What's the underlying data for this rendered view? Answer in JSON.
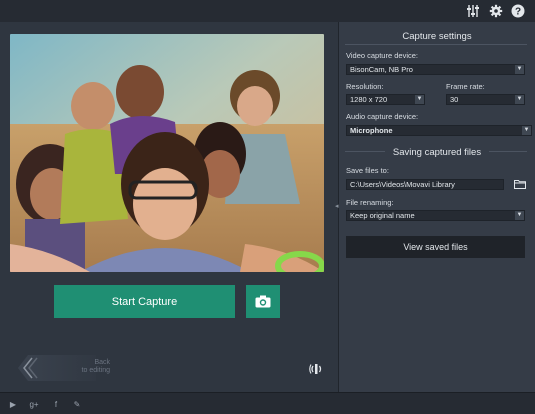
{
  "toolbar": {
    "icons": [
      "equalizer-icon",
      "gear-icon",
      "help-icon"
    ]
  },
  "preview": {
    "description_icon": "camera-preview"
  },
  "actions": {
    "start_capture": "Start Capture",
    "snapshot_icon": "camera-icon",
    "back_line1": "Back",
    "back_line2": "to editing"
  },
  "settings": {
    "capture_title": "Capture settings",
    "video_device_label": "Video capture device:",
    "video_device_value": "BisonCam, NB Pro",
    "resolution_label": "Resolution:",
    "resolution_value": "1280 x 720",
    "frame_rate_label": "Frame rate:",
    "frame_rate_value": "30",
    "audio_device_label": "Audio capture device:",
    "audio_device_value": "Microphone",
    "saving_title": "Saving captured files",
    "save_to_label": "Save files to:",
    "save_to_value": "C:\\Users\\Videos\\Movavi Library",
    "renaming_label": "File renaming:",
    "renaming_value": "Keep original name",
    "view_saved": "View saved files"
  },
  "footer": {
    "icons": [
      "youtube-icon",
      "google-plus-icon",
      "facebook-icon",
      "feedback-icon"
    ],
    "youtube_glyph": "▶",
    "gplus_glyph": "g+",
    "facebook_glyph": "f",
    "feedback_glyph": "✎"
  },
  "colors": {
    "accent": "#1f8f73",
    "panel_dark": "#262b33",
    "panel_right": "#353c47",
    "panel_left": "#2f3640"
  }
}
